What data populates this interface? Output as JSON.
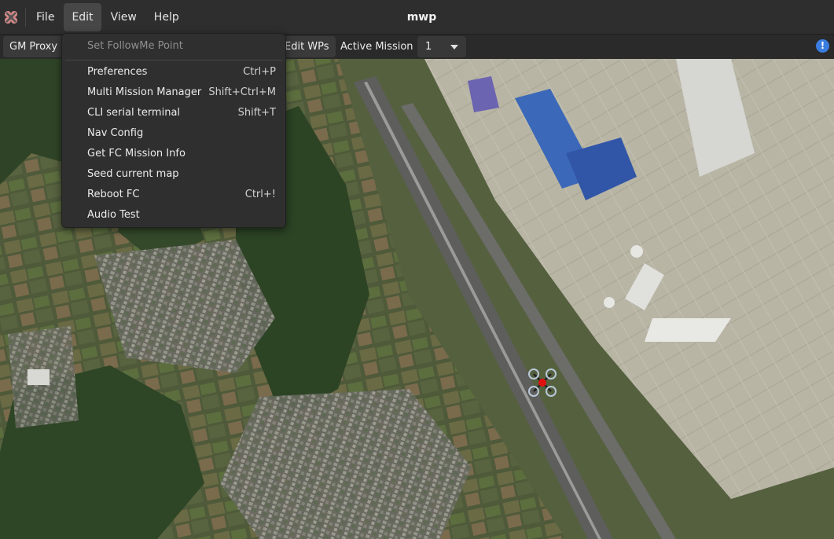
{
  "window": {
    "title": "mwp"
  },
  "menubar": {
    "items": [
      {
        "label": "File"
      },
      {
        "label": "Edit"
      },
      {
        "label": "View"
      },
      {
        "label": "Help"
      }
    ]
  },
  "toolbar": {
    "gm_proxy_label": "GM Proxy",
    "edit_wps_label": "Edit WPs",
    "active_mission_label": "Active Mission",
    "active_mission_value": "1",
    "info_icon": "info-icon"
  },
  "edit_menu": {
    "header": {
      "label": "Set FollowMe Point"
    },
    "items": [
      {
        "label": "Preferences",
        "accel": "Ctrl+P"
      },
      {
        "label": "Multi Mission Manager",
        "accel": "Shift+Ctrl+M"
      },
      {
        "label": "CLI serial terminal",
        "accel": "Shift+T"
      },
      {
        "label": "Nav Config",
        "accel": ""
      },
      {
        "label": "Get FC Mission Info",
        "accel": ""
      },
      {
        "label": "Seed current map",
        "accel": ""
      },
      {
        "label": "Reboot FC",
        "accel": "Ctrl+!"
      },
      {
        "label": "Audio Test",
        "accel": ""
      }
    ]
  },
  "map": {
    "type": "satellite",
    "vehicle_icon": "quadcopter-icon"
  },
  "colors": {
    "menu_bg": "#2f2f2f",
    "active_menu": "#474747",
    "info_blue": "#3b7de0",
    "vehicle_red": "#e01010"
  }
}
